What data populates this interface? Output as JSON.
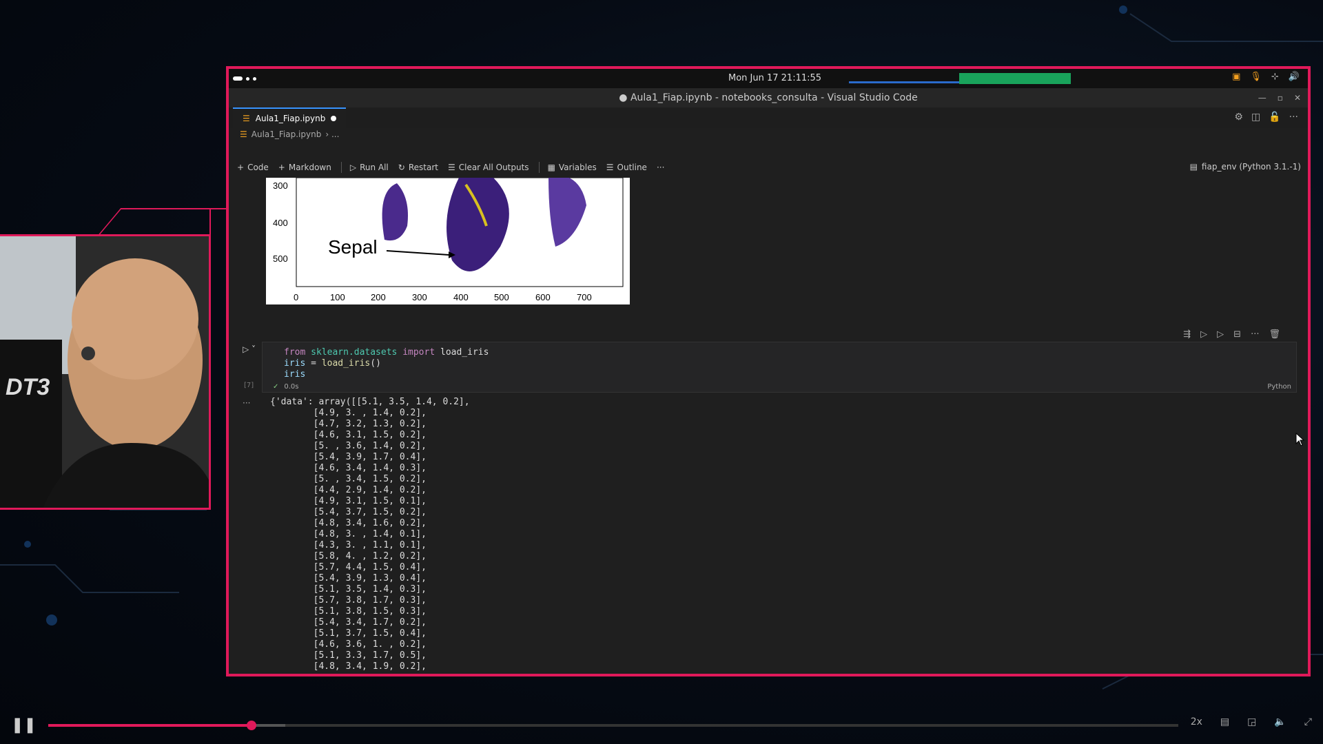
{
  "system_bar": {
    "datetime": "Mon Jun 17  21:11:55"
  },
  "window": {
    "title": "● Aula1_Fiap.ipynb - notebooks_consulta - Visual Studio Code"
  },
  "tab": {
    "label": "Aula1_Fiap.ipynb"
  },
  "breadcrumb": {
    "file": "Aula1_Fiap.ipynb",
    "more": "› ..."
  },
  "toolbar": {
    "code": "Code",
    "markdown": "Markdown",
    "run_all": "Run All",
    "restart": "Restart",
    "clear_outputs": "Clear All Outputs",
    "variables": "Variables",
    "outline": "Outline",
    "more": "···",
    "kernel": "fiap_env (Python 3.1.-1)"
  },
  "plot": {
    "label": "Sepal",
    "y_ticks": [
      "300",
      "400",
      "500"
    ],
    "x_ticks": [
      "0",
      "100",
      "200",
      "300",
      "400",
      "500",
      "600",
      "700"
    ]
  },
  "cell": {
    "exec_count": "[7]",
    "lines": [
      {
        "a": "from ",
        "b": "sklearn.datasets",
        "c": " import ",
        "d": "load_iris"
      },
      {
        "a": "iris",
        "b": " = ",
        "c": "load_iris",
        "d": "()"
      },
      {
        "a": "iris",
        "b": "",
        "c": "",
        "d": ""
      }
    ],
    "time": "0.0s",
    "language": "Python"
  },
  "output": {
    "text": "{'data': array([[5.1, 3.5, 1.4, 0.2],\n        [4.9, 3. , 1.4, 0.2],\n        [4.7, 3.2, 1.3, 0.2],\n        [4.6, 3.1, 1.5, 0.2],\n        [5. , 3.6, 1.4, 0.2],\n        [5.4, 3.9, 1.7, 0.4],\n        [4.6, 3.4, 1.4, 0.3],\n        [5. , 3.4, 1.5, 0.2],\n        [4.4, 2.9, 1.4, 0.2],\n        [4.9, 3.1, 1.5, 0.1],\n        [5.4, 3.7, 1.5, 0.2],\n        [4.8, 3.4, 1.6, 0.2],\n        [4.8, 3. , 1.4, 0.1],\n        [4.3, 3. , 1.1, 0.1],\n        [5.8, 4. , 1.2, 0.2],\n        [5.7, 4.4, 1.5, 0.4],\n        [5.4, 3.9, 1.3, 0.4],\n        [5.1, 3.5, 1.4, 0.3],\n        [5.7, 3.8, 1.7, 0.3],\n        [5.1, 3.8, 1.5, 0.3],\n        [5.4, 3.4, 1.7, 0.2],\n        [5.1, 3.7, 1.5, 0.4],\n        [4.6, 3.6, 1. , 0.2],\n        [5.1, 3.3, 1.7, 0.5],\n        [4.8, 3.4, 1.9, 0.2],"
  },
  "player": {
    "speed": "2x",
    "progress": 0.18,
    "buffered": 0.21
  },
  "colors": {
    "accent": "#e0195a",
    "vscode_bg": "#1f1f1f",
    "tab_active_border": "#3794ff"
  }
}
